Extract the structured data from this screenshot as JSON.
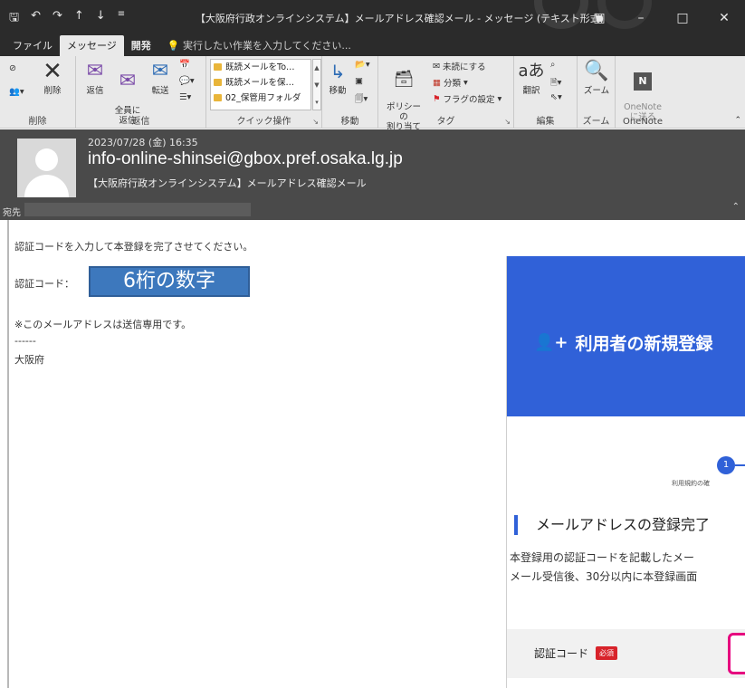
{
  "titlebar": {
    "title": "【大阪府行政オンラインシステム】メールアドレス確認メール - メッセージ (テキスト形式)",
    "qat_icons": [
      "save-icon",
      "undo-icon",
      "redo-icon",
      "up-icon",
      "down-icon",
      "customize-icon"
    ],
    "controls": [
      "restore-ribbon-icon",
      "minimize-icon",
      "maximize-icon",
      "close-icon"
    ]
  },
  "tabs": {
    "file": "ファイル",
    "message": "メッセージ",
    "developer": "開発",
    "tellme": "実行したい作業を入力してください..."
  },
  "ribbon": {
    "delete": {
      "delete_label": "削除",
      "group_label": "削除"
    },
    "respond": {
      "reply": "返信",
      "reply_all": "全員に\n返信",
      "forward": "転送",
      "group_label": "返信"
    },
    "quick_steps": {
      "items": [
        "既読メールをTo…",
        "既読メールを保…",
        "02_保管用フォルダ"
      ],
      "group_label": "クイック操作"
    },
    "move": {
      "move": "移動",
      "group_label": "移動"
    },
    "tags": {
      "policy": "ポリシーの\n割り当て",
      "unread": "未読にする",
      "categorize": "分類",
      "followup": "フラグの設定",
      "group_label": "タグ"
    },
    "editing": {
      "translate": "翻訳",
      "group_label": "編集"
    },
    "zoom": {
      "zoom": "ズーム",
      "group_label": "ズーム"
    },
    "onenote": {
      "send": "OneNote\nに送る",
      "group_label": "OneNote"
    }
  },
  "message": {
    "date": "2023/07/28 (金) 16:35",
    "sender": "info-online-shinsei@gbox.pref.osaka.lg.jp",
    "subject": "【大阪府行政オンラインシステム】メールアドレス確認メール",
    "to_label": "宛先"
  },
  "body": {
    "line1": "認証コードを入力して本登録を完了させてください。",
    "code_label": "認証コード：",
    "code_badge": "6桁の数字",
    "note": "※このメールアドレスは送信専用です。",
    "separator": "------",
    "signature": "大阪府"
  },
  "overlay": {
    "banner_title": "利用者の新規登録",
    "step_number": "1",
    "step_label": "利用規約の確",
    "heading": "メールアドレスの登録完了",
    "para1": "本登録用の認証コードを記載したメー",
    "para2": "メール受信後、30分以内に本登録画面",
    "field_label": "認証コード",
    "required": "必須"
  },
  "colors": {
    "titlebar": "#2b2b2b",
    "ribbon": "#e9e9e9",
    "header": "#4a4a4a",
    "banner": "#3061d8",
    "badge": "#3d78bd",
    "required": "#d8232a",
    "input_border": "#e6007e"
  }
}
